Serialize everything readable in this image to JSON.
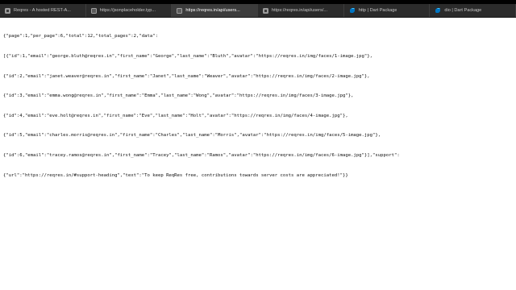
{
  "tabs": [
    {
      "label": "Reqres - A hosted REST-A...",
      "icon": "reqres-favicon-icon",
      "active": false
    },
    {
      "label": "https://jsonplaceholder.typ...",
      "icon": "page-favicon-icon",
      "active": false
    },
    {
      "label": "https://reqres.in/api/users...",
      "icon": "page-favicon-icon",
      "active": true
    },
    {
      "label": "https://reqres.in/api/users/...",
      "icon": "reqres-favicon-icon",
      "active": false
    },
    {
      "label": "http | Dart Package",
      "icon": "dart-icon",
      "active": false
    },
    {
      "label": "dio | Dart Package",
      "icon": "dart-icon",
      "active": false
    }
  ],
  "document": {
    "lines": [
      "{\"page\":1,\"per_page\":6,\"total\":12,\"total_pages\":2,\"data\":",
      "[{\"id\":1,\"email\":\"george.bluth@reqres.in\",\"first_name\":\"George\",\"last_name\":\"Bluth\",\"avatar\":\"https://reqres.in/img/faces/1-image.jpg\"},",
      "{\"id\":2,\"email\":\"janet.weaver@reqres.in\",\"first_name\":\"Janet\",\"last_name\":\"Weaver\",\"avatar\":\"https://reqres.in/img/faces/2-image.jpg\"},",
      "{\"id\":3,\"email\":\"emma.wong@reqres.in\",\"first_name\":\"Emma\",\"last_name\":\"Wong\",\"avatar\":\"https://reqres.in/img/faces/3-image.jpg\"},",
      "{\"id\":4,\"email\":\"eve.holt@reqres.in\",\"first_name\":\"Eve\",\"last_name\":\"Holt\",\"avatar\":\"https://reqres.in/img/faces/4-image.jpg\"},",
      "{\"id\":5,\"email\":\"charles.morris@reqres.in\",\"first_name\":\"Charles\",\"last_name\":\"Morris\",\"avatar\":\"https://reqres.in/img/faces/5-image.jpg\"},",
      "{\"id\":6,\"email\":\"tracey.ramos@reqres.in\",\"first_name\":\"Tracey\",\"last_name\":\"Ramos\",\"avatar\":\"https://reqres.in/img/faces/6-image.jpg\"}],\"support\":",
      "{\"url\":\"https://reqres.in/#support-heading\",\"text\":\"To keep ReqRes free, contributions towards server costs are appreciated!\"}}"
    ]
  },
  "colors": {
    "tabbar_bg": "#2b2b2b",
    "active_tab_bg": "#3c3c3c",
    "page_bg": "#ffffff",
    "outer_bg": "#000000",
    "dart_blue": "#0175C2"
  }
}
